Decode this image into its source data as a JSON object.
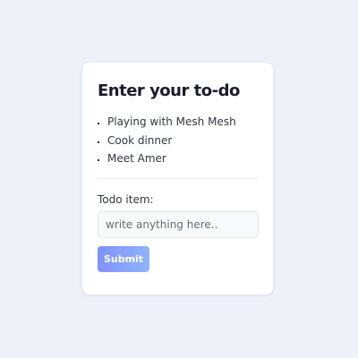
{
  "card": {
    "title": "Enter your to-do",
    "todos": [
      {
        "text": "Playing with Mesh Mesh"
      },
      {
        "text": "Cook dinner"
      },
      {
        "text": "Meet Amer"
      }
    ],
    "form": {
      "label": "Todo item:",
      "input_value": "",
      "input_placeholder": "write anything here..",
      "submit_label": "Submit"
    }
  },
  "colors": {
    "background": "#eef1f8",
    "card": "#ffffff",
    "button_gradient_start": "#7f92fb",
    "button_gradient_end": "#8fb4fb"
  }
}
